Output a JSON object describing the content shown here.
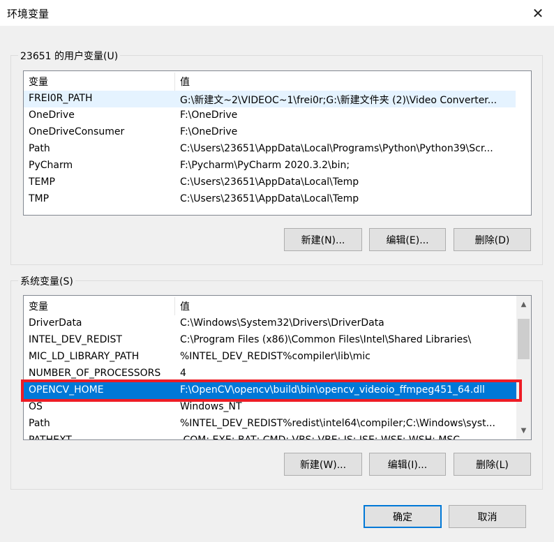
{
  "window": {
    "title": "环境变量",
    "close_glyph": "✕"
  },
  "user_vars": {
    "group_label": "23651 的用户变量(U)",
    "columns": [
      "变量",
      "值"
    ],
    "rows": [
      [
        "FREI0R_PATH",
        "G:\\新建文~2\\VIDEOC~1\\frei0r;G:\\新建文件夹 (2)\\Video Converter..."
      ],
      [
        "OneDrive",
        "F:\\OneDrive"
      ],
      [
        "OneDriveConsumer",
        "F:\\OneDrive"
      ],
      [
        "Path",
        "C:\\Users\\23651\\AppData\\Local\\Programs\\Python\\Python39\\Scr..."
      ],
      [
        "PyCharm",
        "F:\\Pycharm\\PyCharm 2020.3.2\\bin;"
      ],
      [
        "TEMP",
        "C:\\Users\\23651\\AppData\\Local\\Temp"
      ],
      [
        "TMP",
        "C:\\Users\\23651\\AppData\\Local\\Temp"
      ]
    ],
    "buttons": {
      "new": "新建(N)...",
      "edit": "编辑(E)...",
      "delete": "删除(D)"
    }
  },
  "system_vars": {
    "group_label": "系统变量(S)",
    "columns": [
      "变量",
      "值"
    ],
    "rows": [
      [
        "DriverData",
        "C:\\Windows\\System32\\Drivers\\DriverData"
      ],
      [
        "INTEL_DEV_REDIST",
        "C:\\Program Files (x86)\\Common Files\\Intel\\Shared Libraries\\"
      ],
      [
        "MIC_LD_LIBRARY_PATH",
        "%INTEL_DEV_REDIST%compiler\\lib\\mic"
      ],
      [
        "NUMBER_OF_PROCESSORS",
        "4"
      ],
      [
        "OPENCV_HOME",
        "F:\\OpenCV\\opencv\\build\\bin\\opencv_videoio_ffmpeg451_64.dll"
      ],
      [
        "OS",
        "Windows_NT"
      ],
      [
        "Path",
        "%INTEL_DEV_REDIST%redist\\intel64\\compiler;C:\\Windows\\syst..."
      ],
      [
        "PATHEXT",
        ".COM;.EXE;.BAT;.CMD;.VBS;.VBE;.JS;.JSE;.WSF;.WSH;.MSC"
      ]
    ],
    "selected_index": 4,
    "buttons": {
      "new": "新建(W)...",
      "edit": "编辑(I)...",
      "delete": "删除(L)"
    }
  },
  "footer": {
    "ok": "确定",
    "cancel": "取消"
  },
  "colors": {
    "selection": "#0078d7",
    "highlight_border": "#ee1c25"
  }
}
